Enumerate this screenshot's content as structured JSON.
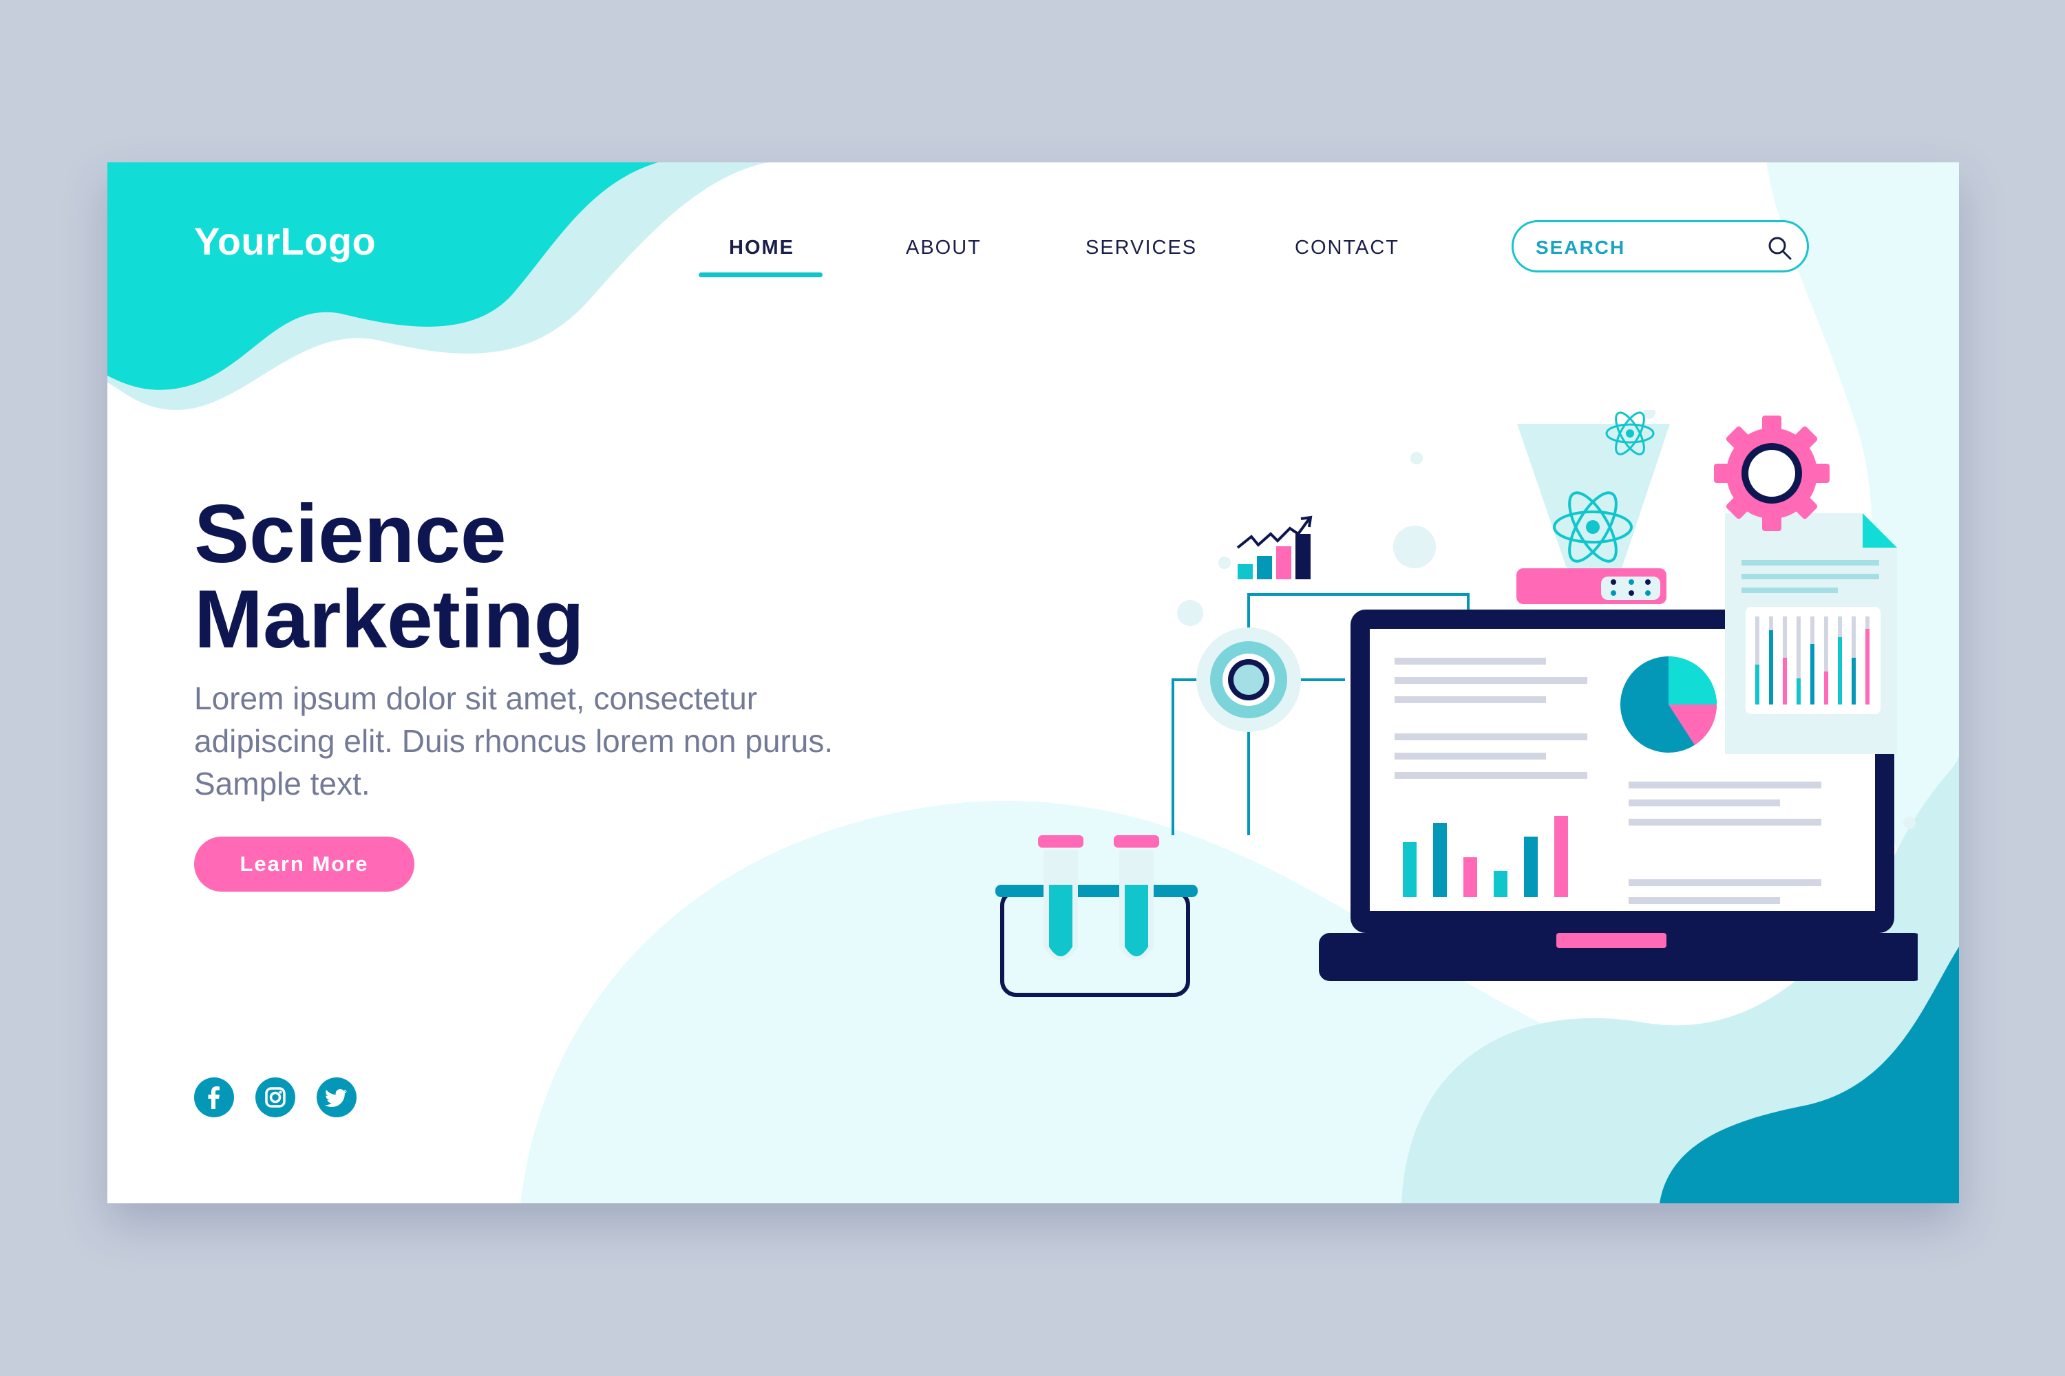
{
  "brand": {
    "logo_text": "YourLogo"
  },
  "nav": {
    "items": [
      {
        "label": "HOME",
        "active": true
      },
      {
        "label": "ABOUT",
        "active": false
      },
      {
        "label": "SERVICES",
        "active": false
      },
      {
        "label": "CONTACT",
        "active": false
      }
    ]
  },
  "search": {
    "placeholder": "SEARCH",
    "value": ""
  },
  "hero": {
    "title_line1": "Science",
    "title_line2": "Marketing",
    "body": "Lorem ipsum dolor sit amet, consectetur adipiscing elit. Duis rhoncus lorem non purus. Sample text.",
    "cta_label": "Learn More"
  },
  "social": {
    "icons": [
      "facebook-icon",
      "instagram-icon",
      "twitter-icon"
    ]
  },
  "colors": {
    "teal": "#11c5cd",
    "dark_teal": "#0398b8",
    "navy": "#0d1650",
    "pink": "#ff69b6",
    "light_bg": "#e7fbfd",
    "page_bg": "#c6cedc"
  }
}
